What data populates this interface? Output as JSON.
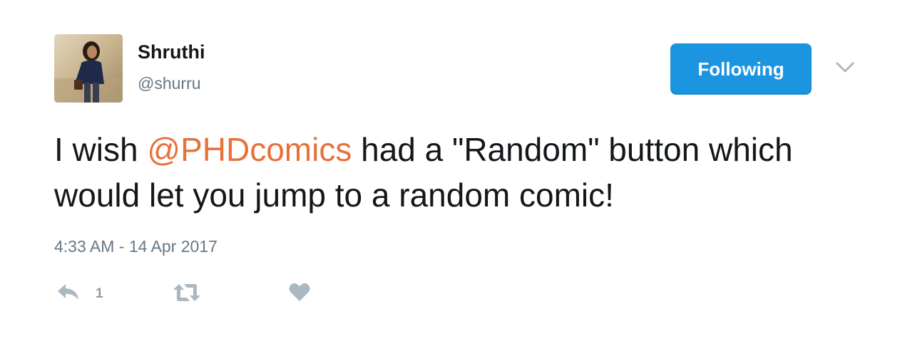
{
  "user": {
    "display_name": "Shruthi",
    "handle": "@shurru"
  },
  "follow_button": {
    "label": "Following"
  },
  "tweet": {
    "text_before": "I wish ",
    "mention": "@PHDcomics",
    "text_after": " had a \"Random\" button which would let you jump to a random comic!",
    "timestamp": "4:33 AM - 14 Apr 2017"
  },
  "actions": {
    "reply_count": "1",
    "reply_icon": "reply-icon",
    "retweet_icon": "retweet-icon",
    "like_icon": "heart-icon",
    "menu_icon": "chevron-down-icon"
  },
  "colors": {
    "accent": "#1b95e0",
    "mention": "#e8713a",
    "secondary_text": "#657786",
    "icon": "#aab8c2"
  }
}
